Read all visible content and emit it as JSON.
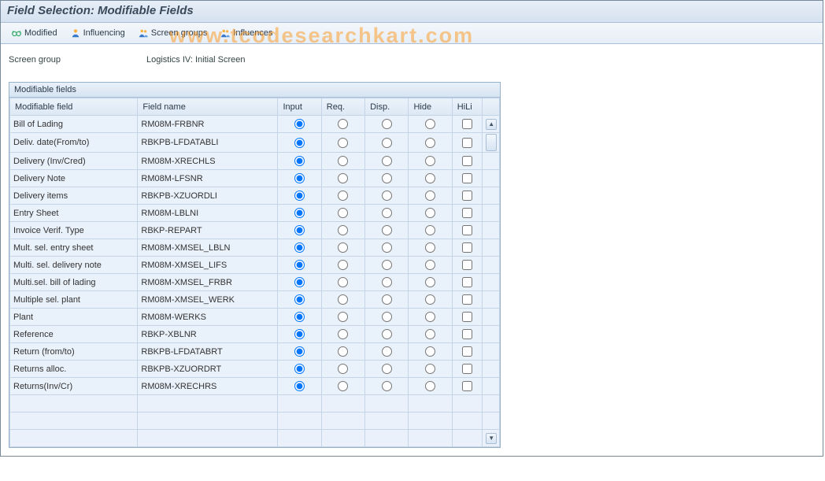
{
  "title": "Field Selection: Modifiable Fields",
  "toolbar": {
    "modified": "Modified",
    "influencing": "Influencing",
    "screen_groups": "Screen groups",
    "influences": "Influences"
  },
  "screen_group": {
    "label": "Screen group",
    "value": "Logistics IV: Initial Screen"
  },
  "panel_title": "Modifiable fields",
  "columns": {
    "field": "Modifiable field",
    "name": "Field name",
    "input": "Input",
    "req": "Req.",
    "disp": "Disp.",
    "hide": "Hide",
    "hili": "HiLi"
  },
  "rows": [
    {
      "field": "Bill of Lading",
      "name": "RM08M-FRBNR",
      "sel": "input"
    },
    {
      "field": "Deliv. date(From/to)",
      "name": "RBKPB-LFDATABLI",
      "sel": "input"
    },
    {
      "field": "Delivery (Inv/Cred)",
      "name": "RM08M-XRECHLS",
      "sel": "input"
    },
    {
      "field": "Delivery Note",
      "name": "RM08M-LFSNR",
      "sel": "input"
    },
    {
      "field": "Delivery items",
      "name": "RBKPB-XZUORDLI",
      "sel": "input"
    },
    {
      "field": "Entry Sheet",
      "name": "RM08M-LBLNI",
      "sel": "input"
    },
    {
      "field": "Invoice Verif. Type",
      "name": "RBKP-REPART",
      "sel": "input"
    },
    {
      "field": "Mult. sel. entry sheet",
      "name": "RM08M-XMSEL_LBLN",
      "sel": "input"
    },
    {
      "field": "Multi. sel. delivery note",
      "name": "RM08M-XMSEL_LIFS",
      "sel": "input"
    },
    {
      "field": "Multi.sel. bill of lading",
      "name": "RM08M-XMSEL_FRBR",
      "sel": "input"
    },
    {
      "field": "Multiple sel. plant",
      "name": "RM08M-XMSEL_WERK",
      "sel": "input"
    },
    {
      "field": "Plant",
      "name": "RM08M-WERKS",
      "sel": "input"
    },
    {
      "field": "Reference",
      "name": "RBKP-XBLNR",
      "sel": "input"
    },
    {
      "field": "Return (from/to)",
      "name": "RBKPB-LFDATABRT",
      "sel": "input"
    },
    {
      "field": "Returns alloc.",
      "name": "RBKPB-XZUORDRT",
      "sel": "input"
    },
    {
      "field": "Returns(Inv/Cr)",
      "name": "RM08M-XRECHRS",
      "sel": "input"
    }
  ],
  "empty_rows": 3,
  "watermark": "www.tcodesearchkart.com"
}
